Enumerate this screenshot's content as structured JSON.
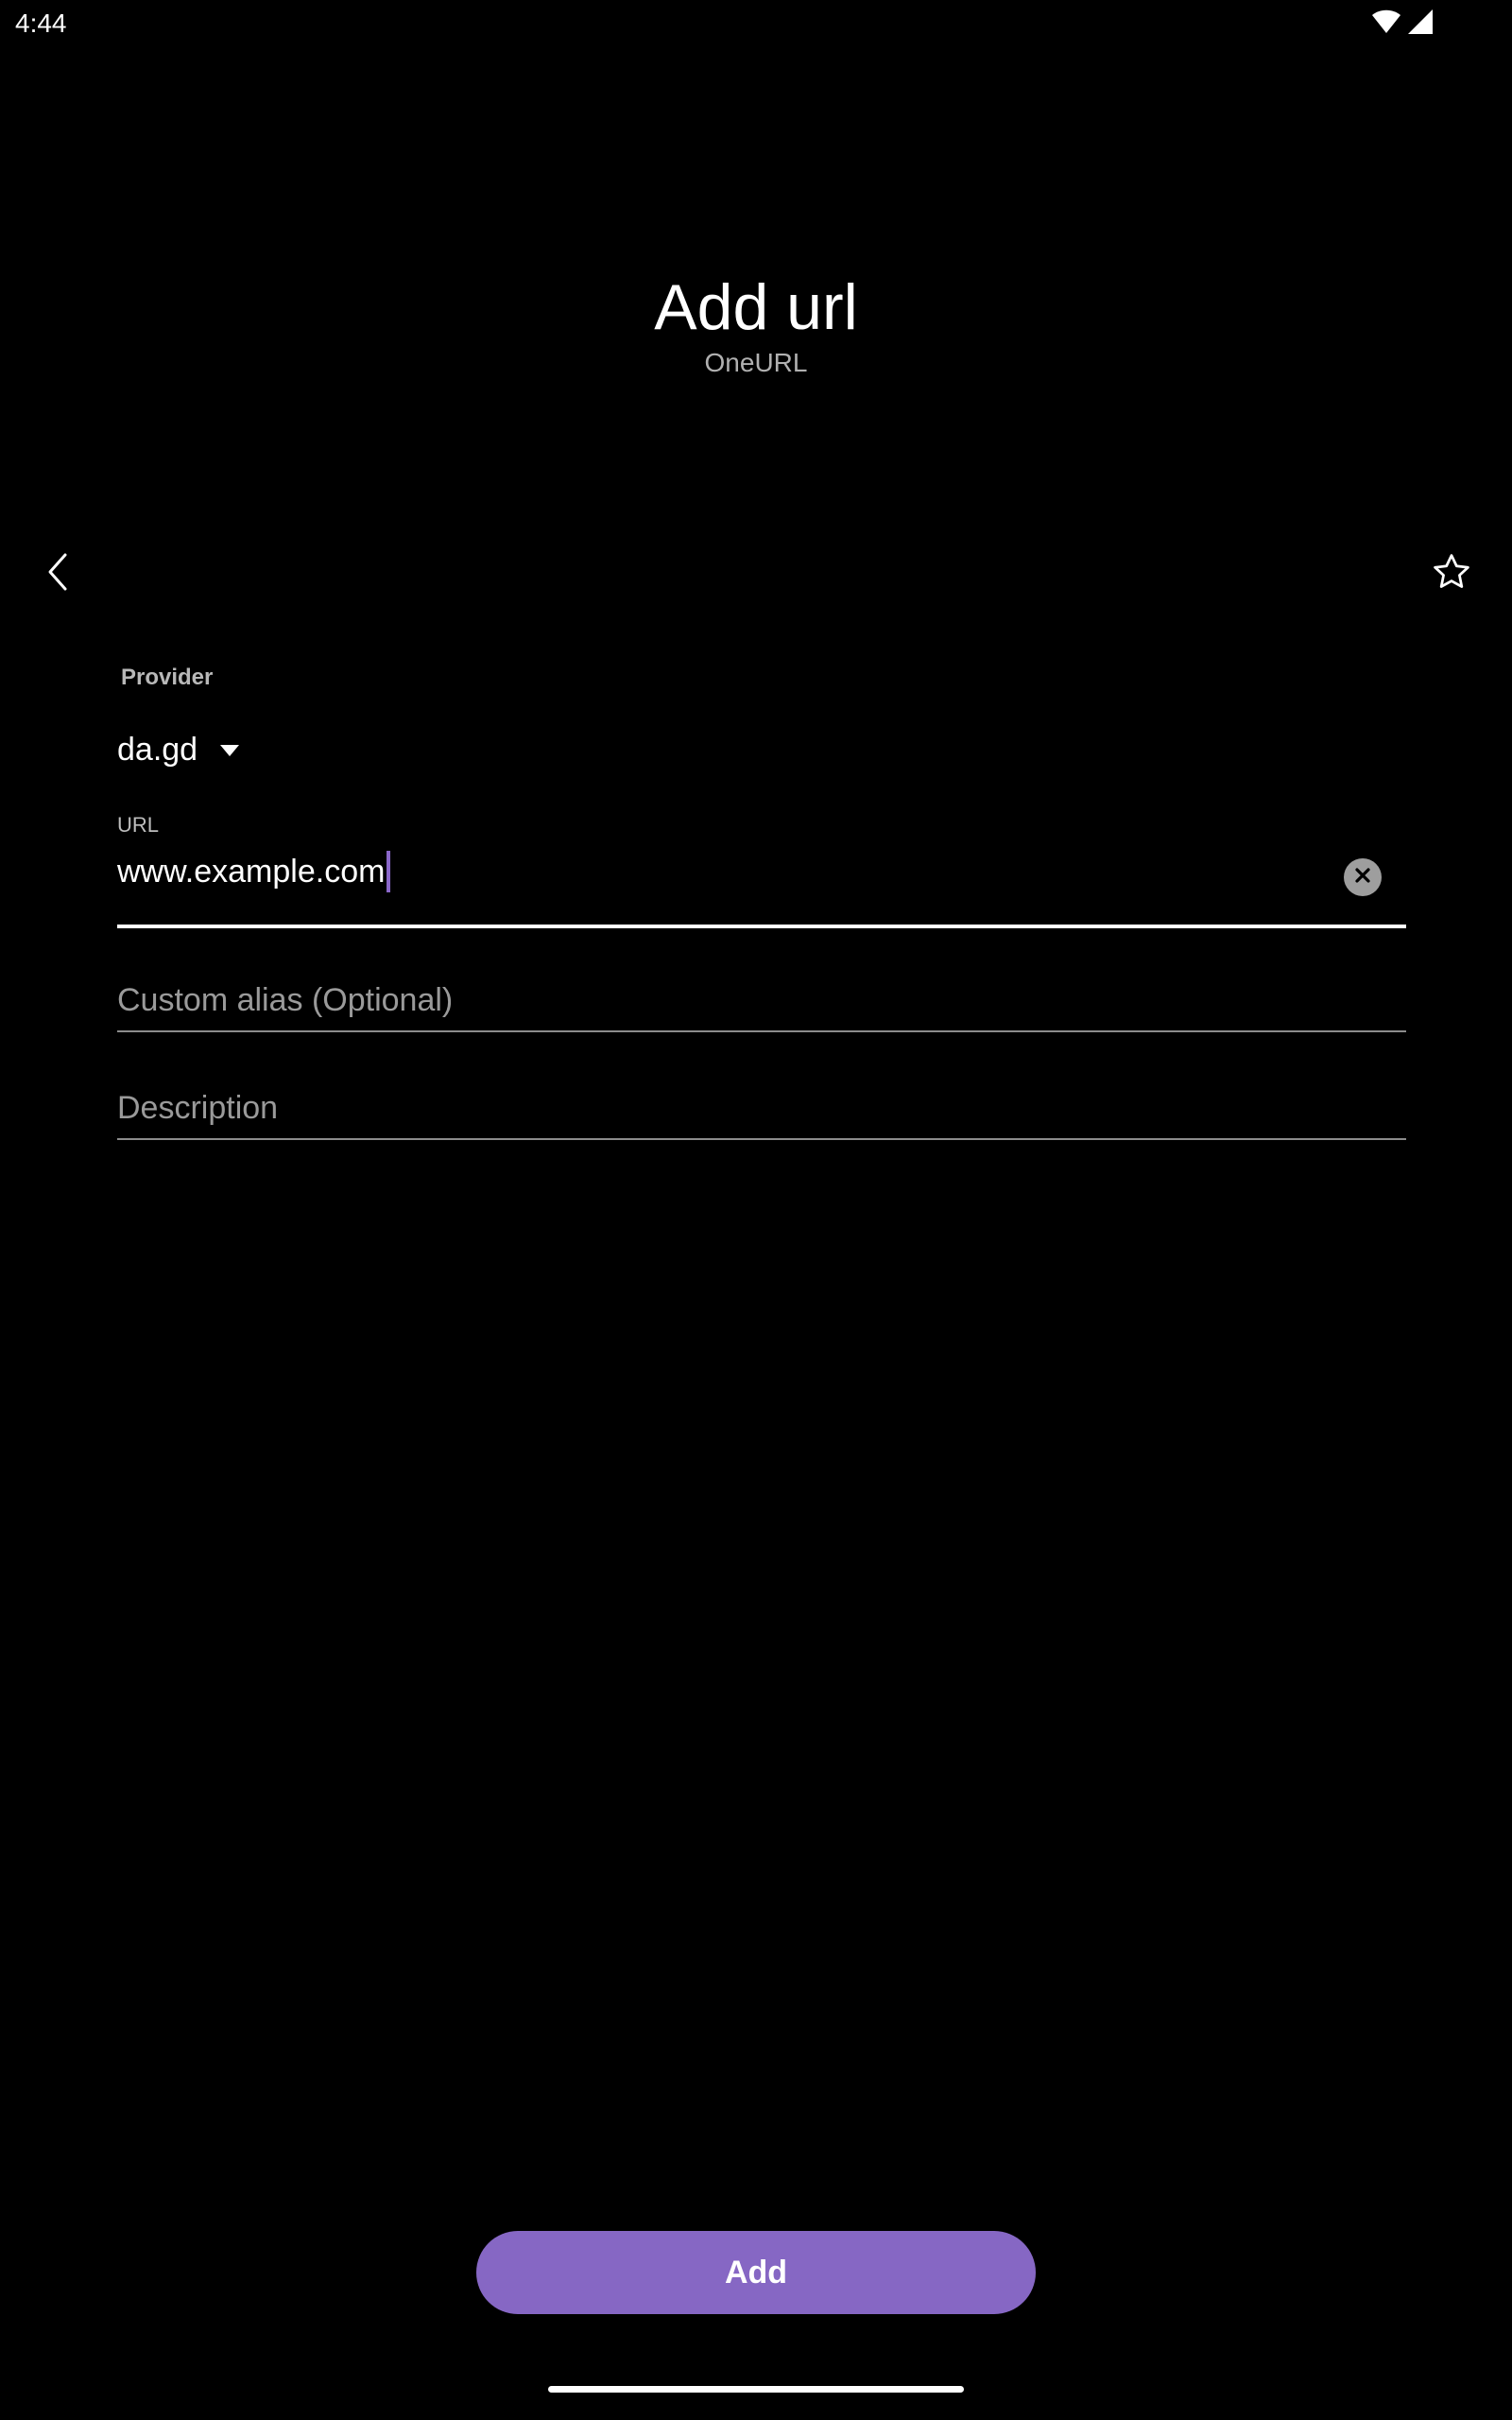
{
  "status_bar": {
    "time": "4:44",
    "icons": [
      "wifi-icon",
      "signal-icon"
    ]
  },
  "header": {
    "title": "Add url",
    "subtitle": "OneURL"
  },
  "toolbar": {
    "back_icon": "chevron-left-icon",
    "favorite_icon": "star-outline-icon"
  },
  "form": {
    "provider": {
      "label": "Provider",
      "selected": "da.gd"
    },
    "url": {
      "label": "URL",
      "value": "www.example.com",
      "clear_icon": "clear-circle-icon"
    },
    "alias": {
      "placeholder": "Custom alias (Optional)"
    },
    "description": {
      "placeholder": "Description"
    }
  },
  "actions": {
    "add_label": "Add"
  },
  "colors": {
    "background": "#000000",
    "accent": "#8667c4",
    "cursor": "#8a67c9"
  }
}
